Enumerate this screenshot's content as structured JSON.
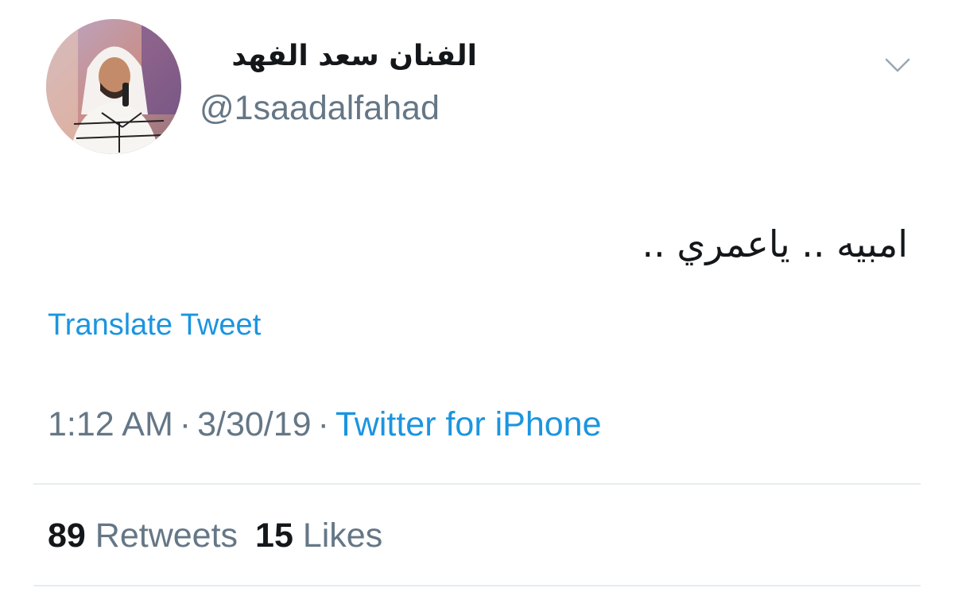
{
  "author": {
    "display_name": "الفنان سعد الفهد",
    "handle": "@1saadalfahad"
  },
  "icons": {
    "menu": "chevron-down-icon"
  },
  "tweet": {
    "text": "امبيه .. ياعمري ..",
    "translate_label": "Translate Tweet"
  },
  "meta": {
    "time": "1:12 AM",
    "separator": "·",
    "date": "3/30/19",
    "source": "Twitter for iPhone"
  },
  "stats": {
    "retweets_count": "89",
    "retweets_label": "Retweets",
    "likes_count": "15",
    "likes_label": "Likes"
  },
  "colors": {
    "link": "#1b95e0",
    "secondary_text": "#657786",
    "primary_text": "#14171a",
    "divider": "#e6ecf0"
  }
}
